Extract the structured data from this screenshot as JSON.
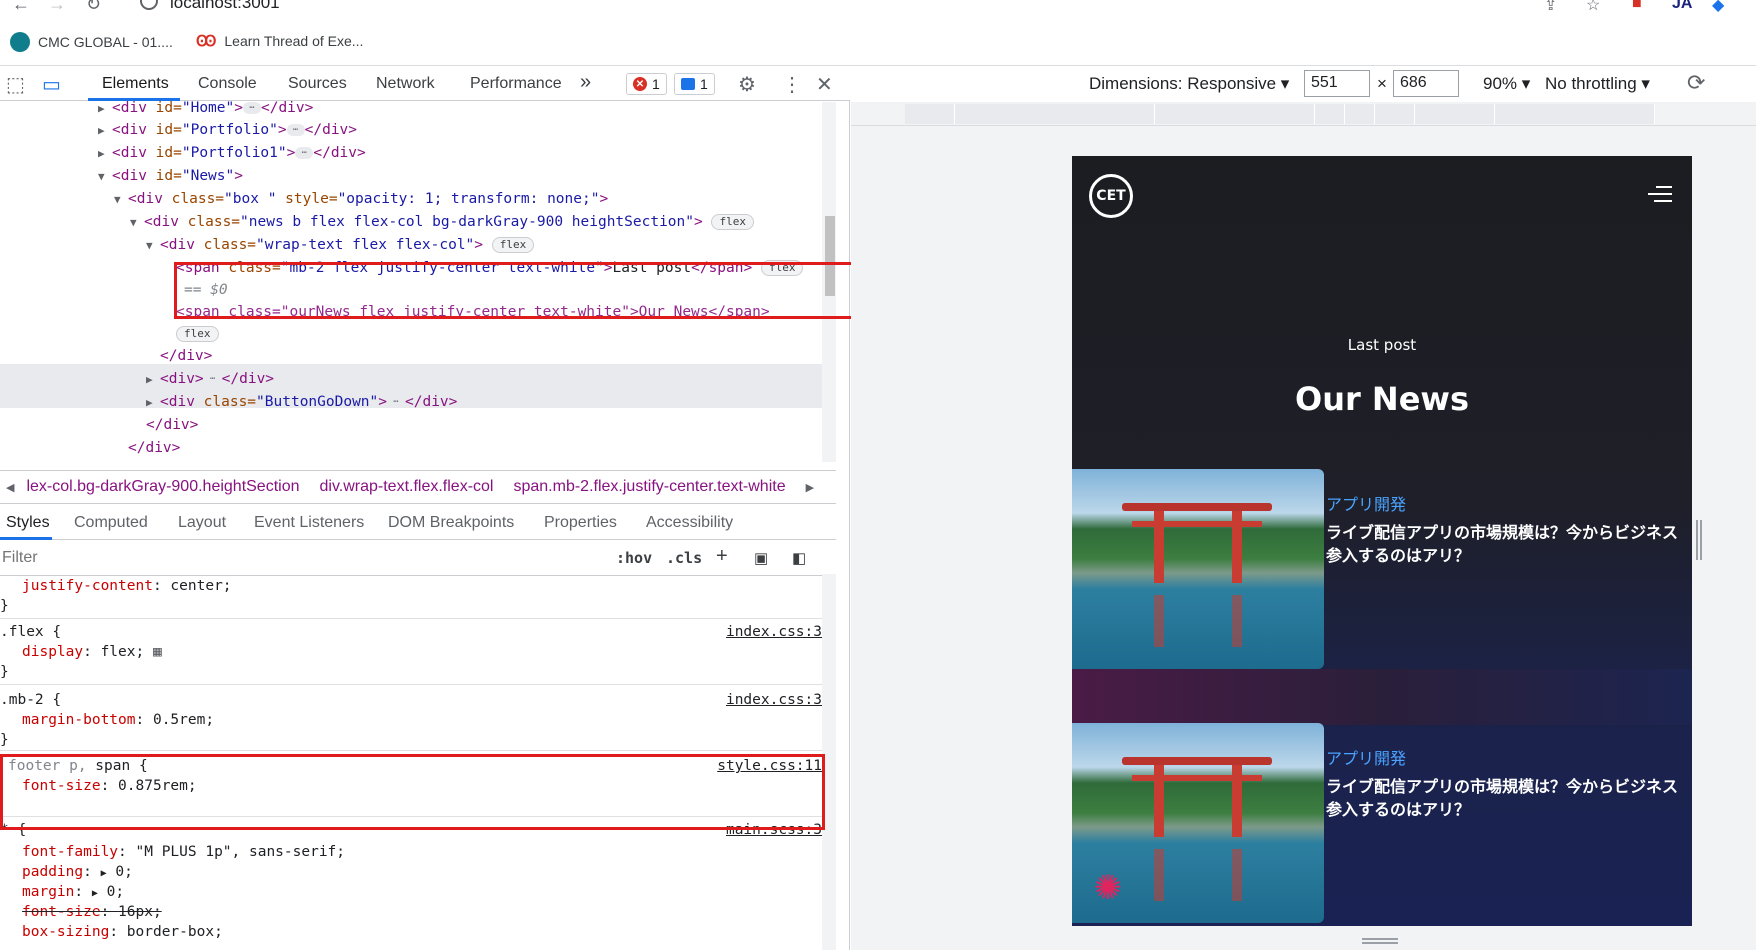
{
  "browser": {
    "url": "localhost:3001",
    "bookmarks": [
      {
        "label": "CMC GLOBAL - 01...."
      },
      {
        "label": "Learn Thread of Exe..."
      }
    ]
  },
  "devtools": {
    "tabs": [
      "Elements",
      "Console",
      "Sources",
      "Network",
      "Performance"
    ],
    "more_tabs": "»",
    "error_count": "1",
    "message_count": "1",
    "dom": {
      "l1_tag": "<div ",
      "l1_attr": "id=",
      "l1_val": "\"Home\"",
      "l1_close": "</div>",
      "l2_val": "\"Portfolio\"",
      "l3_val": "\"Portfolio1\"",
      "l4_val": "\"News\"",
      "l5_val": "\"box \"",
      "l5_style": "style=",
      "l5_styleval": "\"opacity: 1; transform: none;\"",
      "l6_val": "\"news b flex flex-col bg-darkGray-900 heightSection\"",
      "l7_val": "\"wrap-text flex flex-col\"",
      "l8_val": "\"mb-2 flex justify-center text-white\"",
      "l8_text": "Last post",
      "l8_eq": "== $0",
      "l9_text": "<span class=\"ourNews flex justify-center text-white\">Our News</span>",
      "div_close": "</div>",
      "l12_val": "\"ButtonGoDown\"",
      "flex_pill": "flex"
    },
    "breadcrumbs": [
      "lex-col.bg-darkGray-900.heightSection",
      "div.wrap-text.flex.flex-col",
      "span.mb-2.flex.justify-center.text-white"
    ],
    "style_tabs": [
      "Styles",
      "Computed",
      "Layout",
      "Event Listeners",
      "DOM Breakpoints",
      "Properties",
      "Accessibility"
    ],
    "filter_placeholder": "Filter",
    "hov": ":hov",
    "cls": ".cls",
    "rules": {
      "r0_prop": "justify-content",
      "r0_val": "center;",
      "r1_sel": ".flex {",
      "r1_src": "index.css:3",
      "r1_prop": "display",
      "r1_val": "flex;",
      "r2_sel": ".mb-2 {",
      "r2_src": "index.css:3",
      "r2_prop": "margin-bottom",
      "r2_val": "0.5rem;",
      "r3_sel_dim": "footer p,",
      "r3_sel": " span {",
      "r3_src": "style.css:11",
      "r3_prop": "font-size",
      "r3_val": "0.875rem;",
      "r4_sel": "* {",
      "r4_src": "main.scss:3",
      "r4_p1": "font-family",
      "r4_v1": "\"M PLUS 1p\", sans-serif;",
      "r4_p2": "padding",
      "r4_v2": "0;",
      "r4_p3": "margin",
      "r4_v3": "0;",
      "r4_p4": "font-size",
      "r4_v4": "16px;",
      "r4_p5": "box-sizing",
      "r4_v5": "border-box;",
      "close": "}"
    }
  },
  "device_toolbar": {
    "dimensions": "Dimensions: Responsive ▾",
    "width": "551",
    "times": "×",
    "height": "686",
    "zoom": "90% ▾",
    "throttling": "No throttling ▾"
  },
  "site": {
    "logo": "CET",
    "last_post": "Last post",
    "our_news": "Our News",
    "cards": [
      {
        "category": "アプリ開発",
        "title": "ライブ配信アプリの市場規模は？今からビジネス参入するのはアリ？"
      },
      {
        "category": "アプリ開発",
        "title": "ライブ配信アプリの市場規模は？今からビジネス参入するのはアリ？"
      }
    ]
  },
  "colors": {
    "highlight_box": "#e01b1b",
    "accent": "#1a73e8",
    "site_category": "#4aa3ff"
  }
}
